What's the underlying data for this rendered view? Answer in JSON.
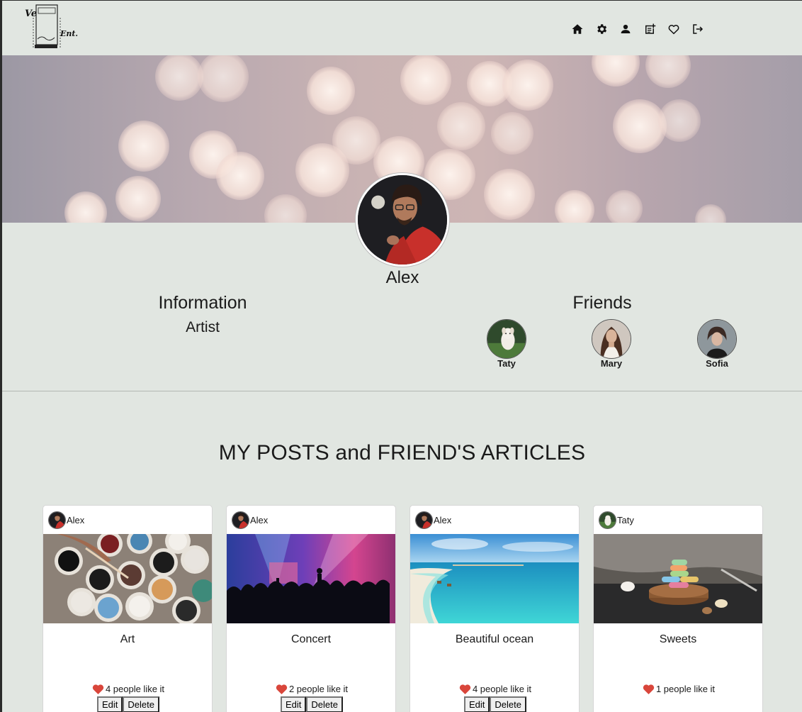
{
  "nav": {
    "icons": [
      "home-icon",
      "gear-icon",
      "user-icon",
      "note-add-icon",
      "heart-icon",
      "logout-icon"
    ]
  },
  "profile": {
    "name": "Alex",
    "info_heading": "Information",
    "info_value": "Artist",
    "friends_heading": "Friends",
    "friends": [
      {
        "name": "Taty"
      },
      {
        "name": "Mary"
      },
      {
        "name": "Sofia"
      }
    ]
  },
  "section": {
    "title": "MY POSTS and FRIEND'S ARTICLES"
  },
  "posts": [
    {
      "author": "Alex",
      "title": "Art",
      "likes": "4 people like it",
      "edit": "Edit",
      "delete": "Delete"
    },
    {
      "author": "Alex",
      "title": "Concert",
      "likes": "2 people like it",
      "edit": "Edit",
      "delete": "Delete"
    },
    {
      "author": "Alex",
      "title": "Beautiful ocean",
      "likes": "4 people like it",
      "edit": "Edit",
      "delete": "Delete"
    },
    {
      "author": "Taty",
      "title": "Sweets",
      "likes": "1 people like it"
    }
  ],
  "colors": {
    "background": "#e1e6e1",
    "heart": "#d9463b",
    "card": "#ffffff"
  }
}
